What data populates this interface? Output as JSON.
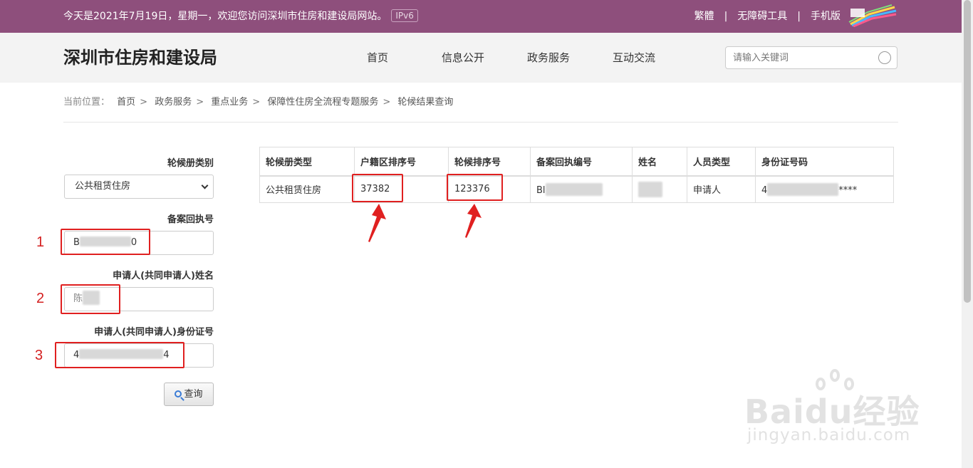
{
  "topbar": {
    "welcome": "今天是2021年7月19日，星期一，欢迎您访问深圳市住房和建设局网站。",
    "ipv6": "IPv6",
    "links": [
      "繁體",
      "无障碍工具",
      "手机版"
    ],
    "separator": "|"
  },
  "header": {
    "site_title": "深圳市住房和建设局",
    "nav": [
      "首页",
      "信息公开",
      "政务服务",
      "互动交流"
    ],
    "search_placeholder": "请输入关键词"
  },
  "breadcrumb": {
    "label": "当前位置：",
    "items": [
      "首页",
      "政务服务",
      "重点业务",
      "保障性住房全流程专题服务",
      "轮候结果查询"
    ],
    "separator": ">"
  },
  "form": {
    "category_label": "轮候册类别",
    "category_value": "公共租赁住房",
    "receipt_label": "备案回执号",
    "receipt_value_start": "B",
    "receipt_value_end": "0",
    "name_label": "申请人(共同申请人)姓名",
    "name_value_start": "陈",
    "id_label": "申请人(共同申请人)身份证号",
    "id_value_start": "4",
    "id_value_end": "4",
    "query_button": "查询"
  },
  "annotations": {
    "markers": [
      "1",
      "2",
      "3"
    ],
    "color": "#e02020"
  },
  "table": {
    "headers": [
      "轮候册类型",
      "户籍区排序号",
      "轮候排序号",
      "备案回执编号",
      "姓名",
      "人员类型",
      "身份证号码"
    ],
    "row": {
      "type": "公共租赁住房",
      "district_rank": "37382",
      "queue_rank": "123376",
      "receipt_start": "Bl",
      "person_type": "申请人",
      "id_start": "4",
      "id_end": "****"
    }
  },
  "watermark": {
    "brand": "Baidu经验",
    "url": "jingyan.baidu.com"
  },
  "colors": {
    "topbar": "#8e4f7c",
    "header_bg": "#f3f3f3",
    "highlight_red": "#e02020"
  }
}
